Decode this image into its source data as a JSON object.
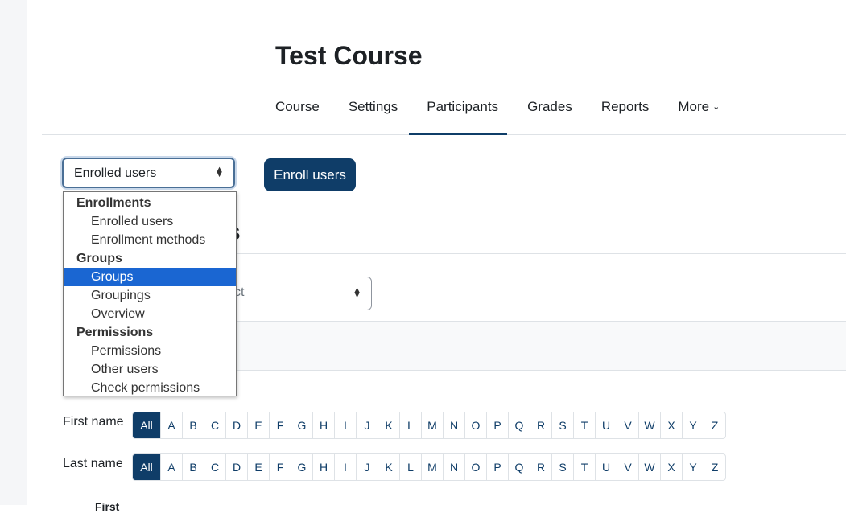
{
  "page": {
    "title": "Test Course"
  },
  "nav": {
    "items": [
      {
        "label": "Course"
      },
      {
        "label": "Settings"
      },
      {
        "label": "Participants",
        "active": true
      },
      {
        "label": "Grades"
      },
      {
        "label": "Reports"
      },
      {
        "label": "More"
      }
    ]
  },
  "toolbar": {
    "selected": "Enrolled users",
    "enroll_button": "Enroll users"
  },
  "dropdown": {
    "groups": [
      {
        "label": "Enrollments",
        "options": [
          "Enrolled users",
          "Enrollment methods"
        ]
      },
      {
        "label": "Groups",
        "options": [
          "Groups",
          "Groupings",
          "Overview"
        ]
      },
      {
        "label": "Permissions",
        "options": [
          "Permissions",
          "Other users",
          "Check permissions"
        ]
      }
    ],
    "highlighted": "Groups"
  },
  "background": {
    "heading_fragment": "s",
    "select_fragment": "ct",
    "bottom_fragment": "First"
  },
  "filters": {
    "first_name_label": "First name",
    "last_name_label": "Last name",
    "all_label": "All",
    "letters": [
      "A",
      "B",
      "C",
      "D",
      "E",
      "F",
      "G",
      "H",
      "I",
      "J",
      "K",
      "L",
      "M",
      "N",
      "O",
      "P",
      "Q",
      "R",
      "S",
      "T",
      "U",
      "V",
      "W",
      "X",
      "Y",
      "Z"
    ]
  },
  "colors": {
    "primary": "#0f3d68",
    "highlight": "#1a66d2"
  }
}
